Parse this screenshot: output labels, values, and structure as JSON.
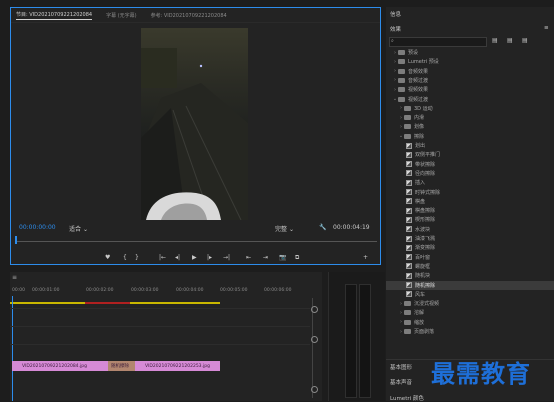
{
  "monitor": {
    "tabs": [
      {
        "label": "节目: VID20210709221202084",
        "active": true
      },
      {
        "label": "字幕 (无字幕)",
        "active": false
      },
      {
        "label": "参考: VID20210709221202084",
        "active": false
      }
    ],
    "timecode_current": "00:00:00:00",
    "fit_option": "适合",
    "quality": "完整",
    "timecode_duration": "00:00:04:19",
    "buttons": [
      "♥",
      "{",
      "}",
      "|←",
      "◂|",
      "▶",
      "|▸",
      "→|",
      "⇤",
      "⇥",
      "📷",
      "⧉",
      "+"
    ]
  },
  "effects_panel": {
    "info_tab": "信息",
    "title": "效果",
    "search_placeholder": "",
    "items": [
      {
        "label": "预设",
        "type": "folder",
        "level": 0
      },
      {
        "label": "Lumetri 预设",
        "type": "folder",
        "level": 0
      },
      {
        "label": "音频效果",
        "type": "folder",
        "level": 0
      },
      {
        "label": "音频过渡",
        "type": "folder",
        "level": 0
      },
      {
        "label": "视频效果",
        "type": "folder",
        "level": 0
      },
      {
        "label": "视频过渡",
        "type": "folder",
        "level": 0,
        "open": true
      },
      {
        "label": "3D 运动",
        "type": "folder",
        "level": 1
      },
      {
        "label": "内滑",
        "type": "folder",
        "level": 1
      },
      {
        "label": "划像",
        "type": "folder",
        "level": 1
      },
      {
        "label": "擦除",
        "type": "folder",
        "level": 1,
        "open": true
      },
      {
        "label": "划出",
        "type": "effect",
        "level": 2
      },
      {
        "label": "双侧平推门",
        "type": "effect",
        "level": 2
      },
      {
        "label": "带状擦除",
        "type": "effect",
        "level": 2
      },
      {
        "label": "径向擦除",
        "type": "effect",
        "level": 2
      },
      {
        "label": "插入",
        "type": "effect",
        "level": 2
      },
      {
        "label": "时钟式擦除",
        "type": "effect",
        "level": 2
      },
      {
        "label": "棋盘",
        "type": "effect",
        "level": 2
      },
      {
        "label": "棋盘擦除",
        "type": "effect",
        "level": 2
      },
      {
        "label": "楔形擦除",
        "type": "effect",
        "level": 2
      },
      {
        "label": "水波块",
        "type": "effect",
        "level": 2
      },
      {
        "label": "油漆飞溅",
        "type": "effect",
        "level": 2
      },
      {
        "label": "渐变擦除",
        "type": "effect",
        "level": 2
      },
      {
        "label": "百叶窗",
        "type": "effect",
        "level": 2
      },
      {
        "label": "螺旋框",
        "type": "effect",
        "level": 2
      },
      {
        "label": "随机块",
        "type": "effect",
        "level": 2
      },
      {
        "label": "随机擦除",
        "type": "effect",
        "level": 2,
        "selected": true
      },
      {
        "label": "风车",
        "type": "effect",
        "level": 2
      },
      {
        "label": "沉浸式视频",
        "type": "folder",
        "level": 1
      },
      {
        "label": "溶解",
        "type": "folder",
        "level": 1
      },
      {
        "label": "缩放",
        "type": "folder",
        "level": 1
      },
      {
        "label": "页面剥落",
        "type": "folder",
        "level": 1
      }
    ],
    "bottom_sections": [
      "基本图形",
      "基本声音",
      "Lumetri 颜色"
    ]
  },
  "timeline": {
    "ruler_labels": [
      "00:00",
      "00:00:01:00",
      "00:00:02:00",
      "00:00:03:00",
      "00:00:04:00",
      "00:00:05:00",
      "00:00:06:00"
    ],
    "clips": [
      {
        "label": "VID20210709221202084.jpg"
      },
      {
        "label": "随机擦除"
      },
      {
        "label": "VID20210709221202253.jpg"
      }
    ]
  },
  "watermark": "最需教育"
}
